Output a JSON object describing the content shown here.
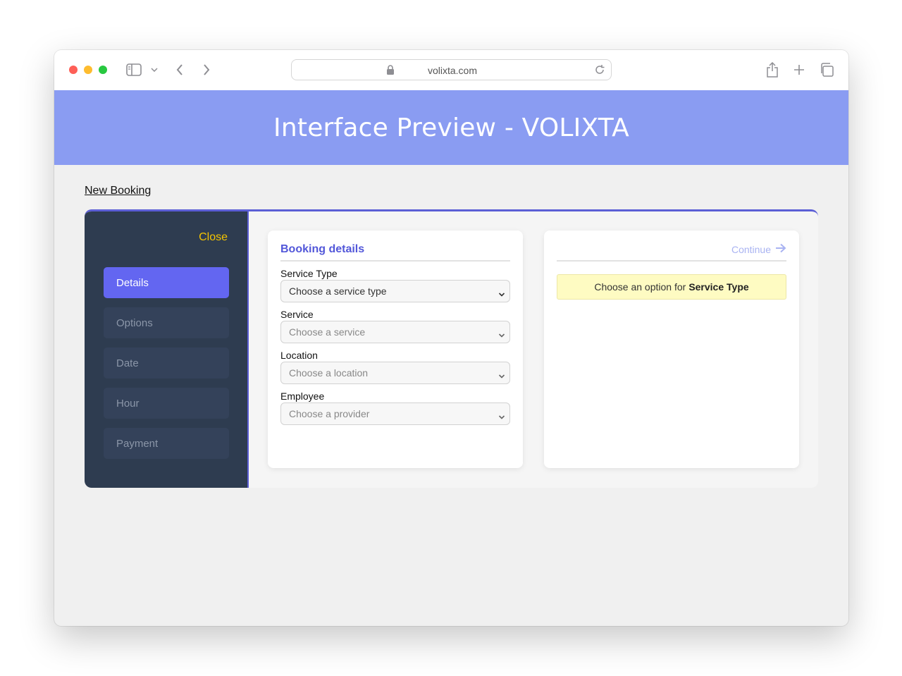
{
  "browser": {
    "url": "volixta.com"
  },
  "page": {
    "banner_title": "Interface Preview - VOLIXTA",
    "new_booking_link": "New Booking"
  },
  "sidebar": {
    "close_label": "Close",
    "steps": [
      {
        "label": "Details",
        "active": true
      },
      {
        "label": "Options",
        "active": false
      },
      {
        "label": "Date",
        "active": false
      },
      {
        "label": "Hour",
        "active": false
      },
      {
        "label": "Payment",
        "active": false
      }
    ]
  },
  "form": {
    "title": "Booking details",
    "fields": [
      {
        "label": "Service Type",
        "value": "Choose a service type"
      },
      {
        "label": "Service",
        "value": "Choose a service"
      },
      {
        "label": "Location",
        "value": "Choose a location"
      },
      {
        "label": "Employee",
        "value": "Choose a provider"
      }
    ]
  },
  "summary": {
    "continue_label": "Continue",
    "alert_prefix": "Choose an option for",
    "alert_emphasis": "Service Type"
  },
  "colors": {
    "banner": "#8a9cf2",
    "accent": "#6366f1",
    "sidebar_bg": "#2e3c50",
    "close_link": "#f5c400",
    "alert_bg": "#fefbc2"
  }
}
